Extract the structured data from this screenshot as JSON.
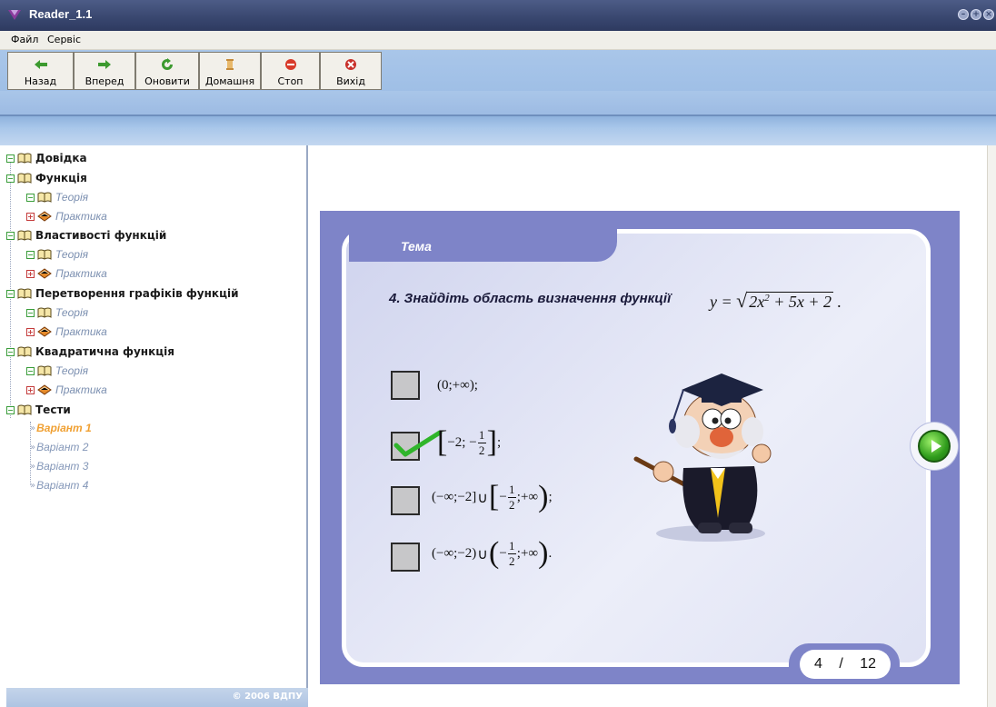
{
  "window": {
    "title": "Reader_1.1"
  },
  "menu": [
    "Файл",
    "Сервіс"
  ],
  "toolbar": {
    "buttons": [
      {
        "label": "Назад",
        "icon": "arrow-left-icon"
      },
      {
        "label": "Вперед",
        "icon": "arrow-right-icon"
      },
      {
        "label": "Оновити",
        "icon": "refresh-icon"
      },
      {
        "label": "Домашня",
        "icon": "home-scroll-icon"
      },
      {
        "label": "Стоп",
        "icon": "stop-icon"
      },
      {
        "label": "Вихід",
        "icon": "exit-icon"
      }
    ]
  },
  "tree": {
    "sections": [
      {
        "label": "Довідка"
      },
      {
        "label": "Функція",
        "children": [
          "Теорія",
          "Практика"
        ]
      },
      {
        "label": "Властивості функцій",
        "children": [
          "Теорія",
          "Практика"
        ]
      },
      {
        "label": "Перетворення графіків функцій",
        "children": [
          "Теорія",
          "Практика"
        ]
      },
      {
        "label": "Квадратична функція",
        "children": [
          "Теорія",
          "Практика"
        ]
      },
      {
        "label": "Тести"
      }
    ],
    "variants": [
      "Варіант 1",
      "Варіант 2",
      "Варіант 3",
      "Варіант 4"
    ],
    "active_variant": "Варіант 1"
  },
  "footer": {
    "copyright": "© 2006 ВДПУ"
  },
  "card": {
    "tab_label": "Тема",
    "question": "4. Знайдіть область визначення функції",
    "options": [
      {
        "checked": false
      },
      {
        "checked": true
      },
      {
        "checked": false
      },
      {
        "checked": false
      }
    ],
    "page_current": "4",
    "page_separator": "/",
    "page_total": "12"
  },
  "colors": {
    "card_frame": "#7e84c8",
    "check": "#2fb52a",
    "titlebar": "#38466e"
  }
}
